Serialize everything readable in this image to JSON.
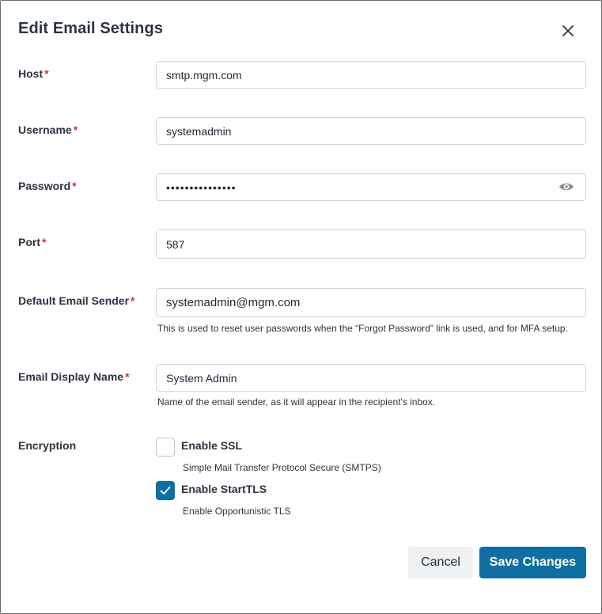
{
  "dialog": {
    "title": "Edit Email Settings"
  },
  "required_marker": "*",
  "fields": {
    "host": {
      "label": "Host",
      "value": "smtp.mgm.com"
    },
    "username": {
      "label": "Username",
      "value": "systemadmin"
    },
    "password": {
      "label": "Password",
      "value": "•••••••••••••••"
    },
    "port": {
      "label": "Port",
      "value": "587"
    },
    "sender": {
      "label": "Default Email Sender",
      "value": "systemadmin@mgm.com",
      "hint": "This is used to reset user passwords when the “Forgot Password” link is used, and for MFA setup."
    },
    "display_name": {
      "label": "Email Display Name",
      "value": "System Admin",
      "hint": "Name of the email sender, as it will appear in the recipient's inbox."
    }
  },
  "encryption": {
    "label": "Encryption",
    "ssl": {
      "label": "Enable SSL",
      "description": "Simple Mail Transfer Protocol Secure (SMTPS)",
      "checked": false
    },
    "starttls": {
      "label": "Enable StartTLS",
      "description": "Enable Opportunistic TLS",
      "checked": true
    }
  },
  "actions": {
    "cancel_label": "Cancel",
    "save_label": "Save Changes"
  },
  "colors": {
    "primary": "#0f6fa3",
    "required": "#d0343a"
  },
  "icons": {
    "close": "close-icon",
    "reveal_password": "eye-icon",
    "check": "checkmark-icon"
  }
}
